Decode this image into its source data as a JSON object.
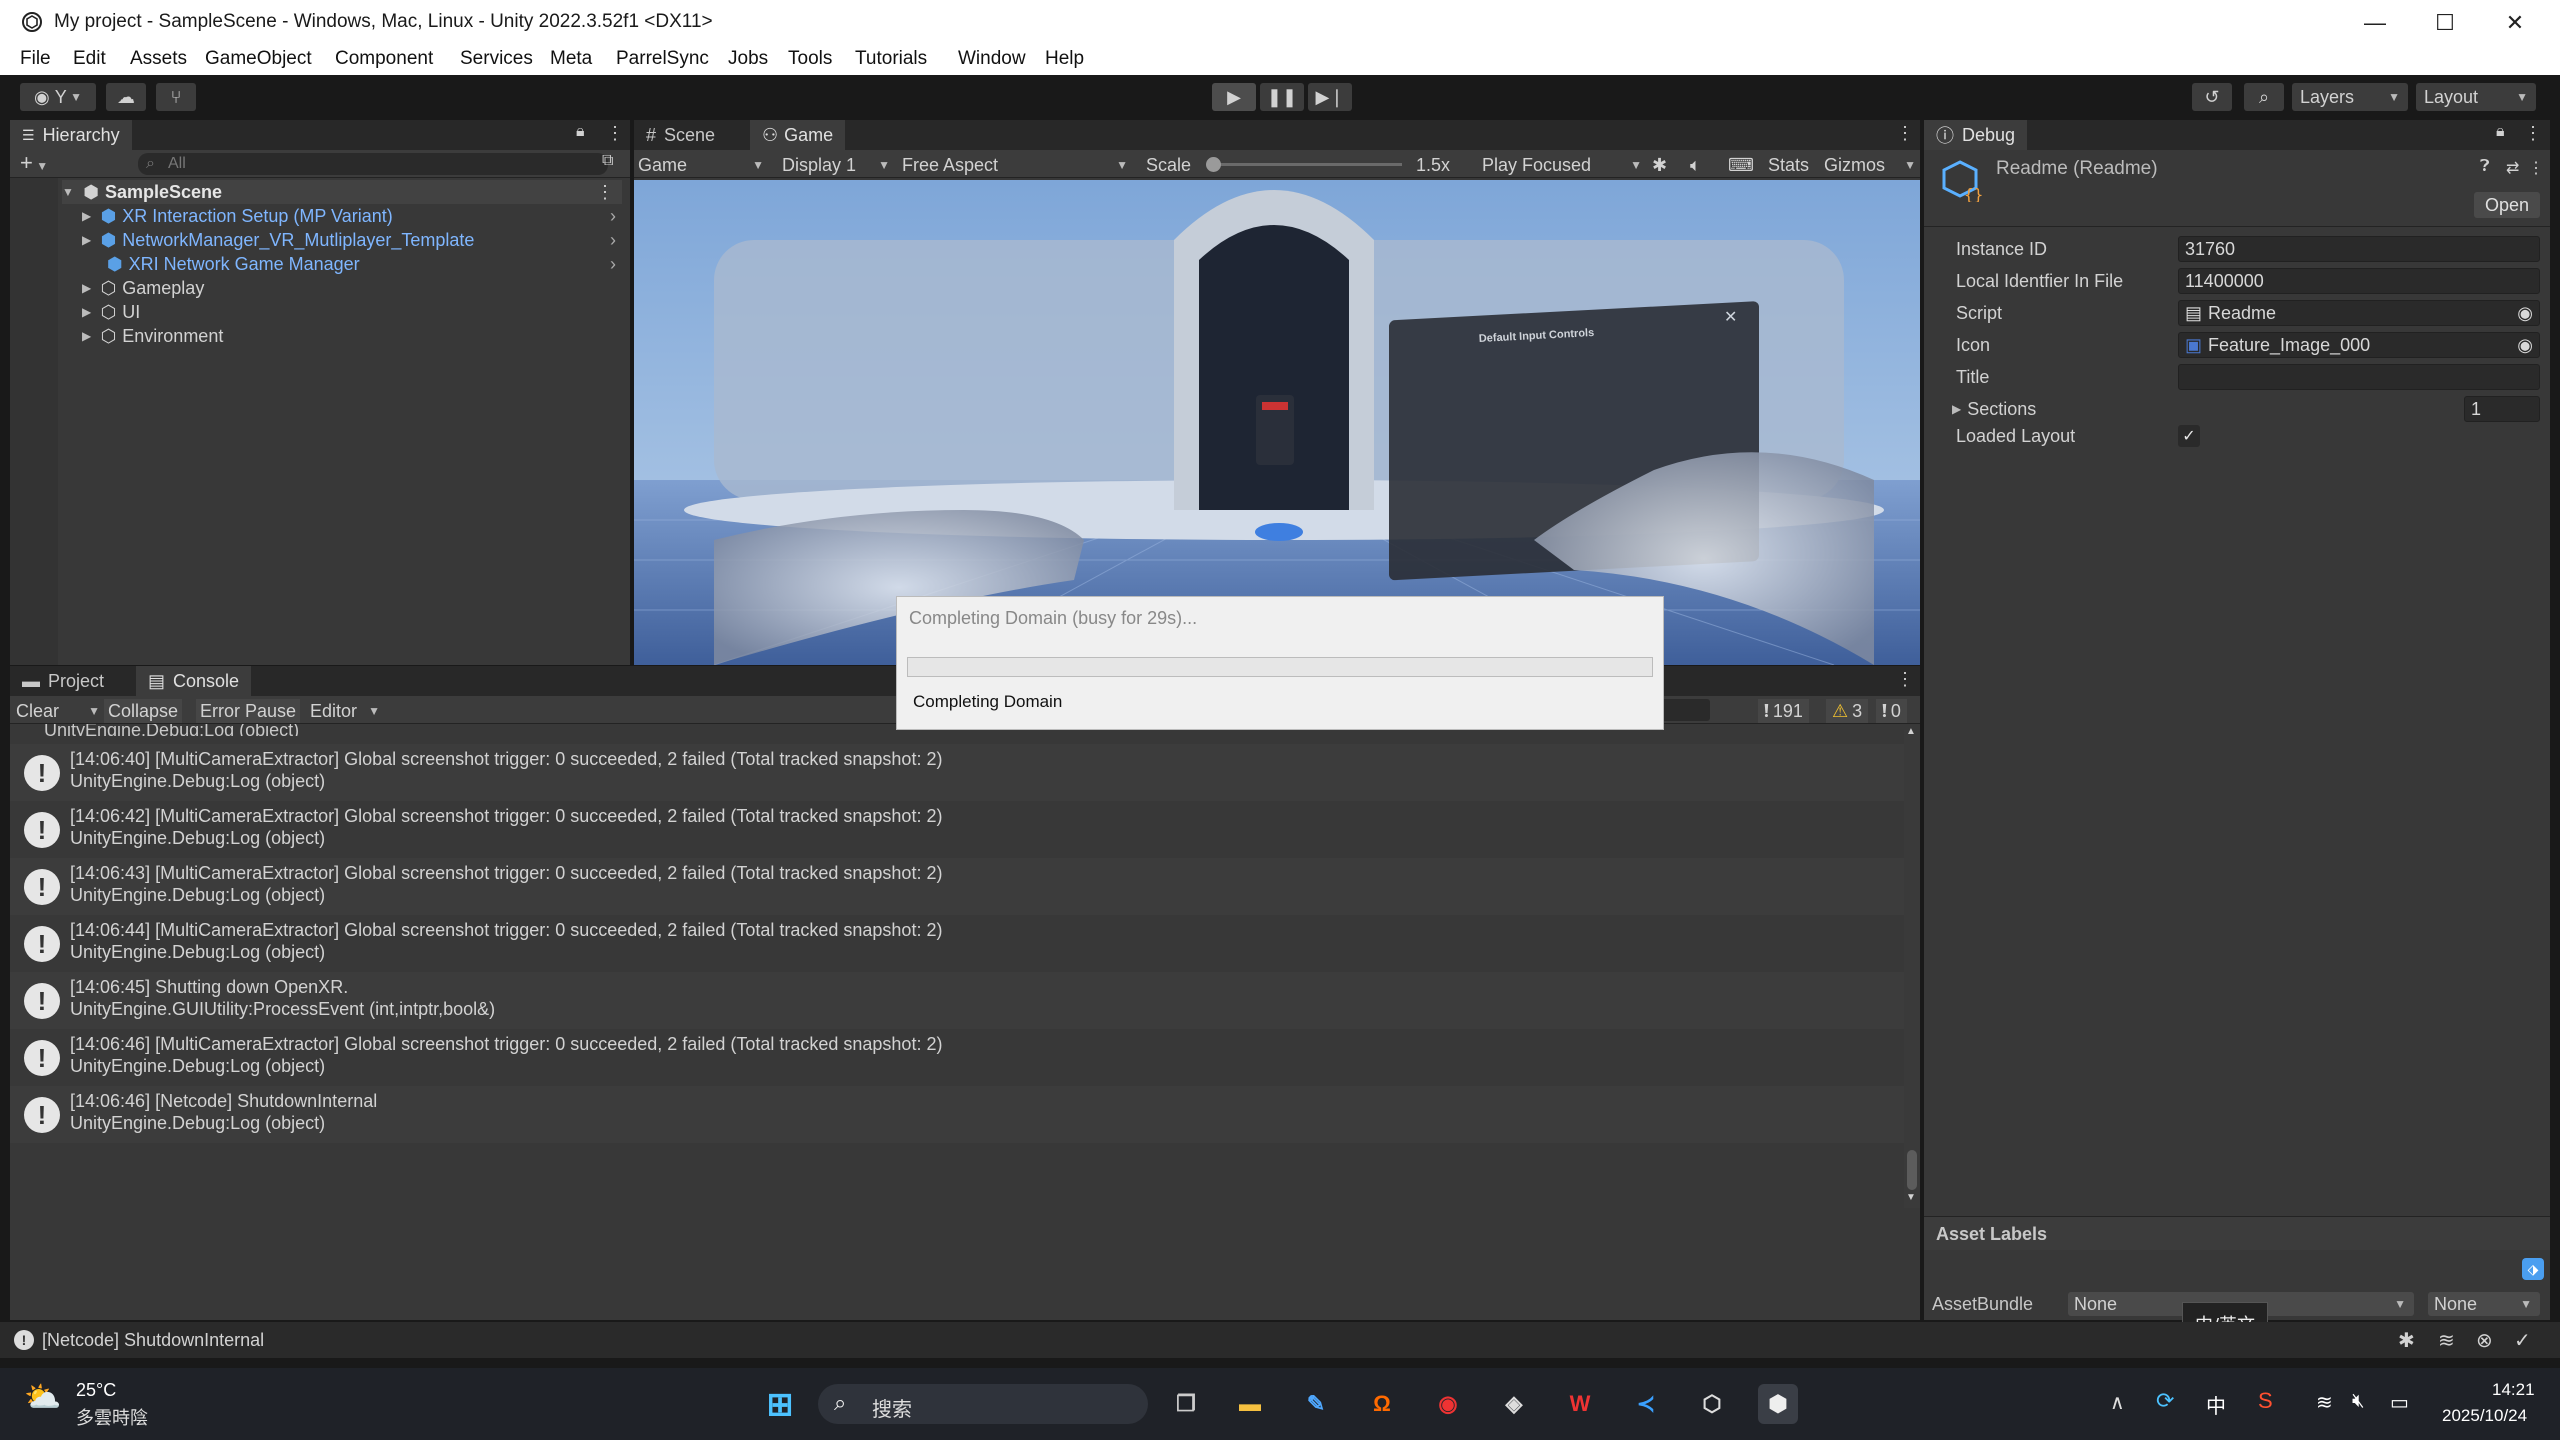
{
  "window": {
    "title": "My project - SampleScene - Windows, Mac, Linux - Unity 2022.3.52f1 <DX11>",
    "minimize": "—",
    "maximize": "☐",
    "close": "✕"
  },
  "menu": [
    "File",
    "Edit",
    "Assets",
    "GameObject",
    "Component",
    "Services",
    "Meta",
    "ParrelSync",
    "Jobs",
    "Tools",
    "Tutorials",
    "Window",
    "Help"
  ],
  "toolbar": {
    "account": "Y",
    "layers": "Layers",
    "layout": "Layout"
  },
  "hierarchy": {
    "tab": "Hierarchy",
    "search_placeholder": "All",
    "scene": "SampleScene",
    "items": [
      {
        "label": "XR Interaction Setup (MP Variant)",
        "prefab": true
      },
      {
        "label": "NetworkManager_VR_Mutliplayer_Template",
        "prefab": true
      },
      {
        "label": "XRI Network Game Manager",
        "prefab": true
      },
      {
        "label": "Gameplay",
        "prefab": false
      },
      {
        "label": "UI",
        "prefab": false
      },
      {
        "label": "Environment",
        "prefab": false
      }
    ]
  },
  "game_view": {
    "tab_scene": "Scene",
    "tab_game": "Game",
    "mode": "Game",
    "display": "Display 1",
    "aspect": "Free Aspect",
    "scale_label": "Scale",
    "scale_value": "1.5x",
    "play_mode": "Play Focused",
    "stats": "Stats",
    "gizmos": "Gizmos",
    "panel_title": "Default Input Controls"
  },
  "progress_dialog": {
    "title": "Completing Domain (busy for 29s)...",
    "status": "Completing Domain"
  },
  "console": {
    "tab_project": "Project",
    "tab_console": "Console",
    "clear": "Clear",
    "collapse": "Collapse",
    "error_pause": "Error Pause",
    "editor": "Editor",
    "count_logs": "191",
    "count_warnings": "3",
    "count_errors": "0",
    "partial_line": "UnityEngine.Debug:Log (object)",
    "entries": [
      {
        "line1": "[14:06:40] [MultiCameraExtractor] Global screenshot trigger: 0 succeeded, 2 failed (Total tracked snapshot: 2)",
        "line2": "UnityEngine.Debug:Log (object)"
      },
      {
        "line1": "[14:06:42] [MultiCameraExtractor] Global screenshot trigger: 0 succeeded, 2 failed (Total tracked snapshot: 2)",
        "line2": "UnityEngine.Debug:Log (object)"
      },
      {
        "line1": "[14:06:43] [MultiCameraExtractor] Global screenshot trigger: 0 succeeded, 2 failed (Total tracked snapshot: 2)",
        "line2": "UnityEngine.Debug:Log (object)"
      },
      {
        "line1": "[14:06:44] [MultiCameraExtractor] Global screenshot trigger: 0 succeeded, 2 failed (Total tracked snapshot: 2)",
        "line2": "UnityEngine.Debug:Log (object)"
      },
      {
        "line1": "[14:06:45] Shutting down OpenXR.",
        "line2": "UnityEngine.GUIUtility:ProcessEvent (int,intptr,bool&)"
      },
      {
        "line1": "[14:06:46] [MultiCameraExtractor] Global screenshot trigger: 0 succeeded, 2 failed (Total tracked snapshot: 2)",
        "line2": "UnityEngine.Debug:Log (object)"
      },
      {
        "line1": "[14:06:46] [Netcode] ShutdownInternal",
        "line2": "UnityEngine.Debug:Log (object)"
      }
    ]
  },
  "inspector": {
    "tab": "Debug",
    "object_name": "Readme (Readme)",
    "open": "Open",
    "fields": [
      {
        "label": "Instance ID",
        "value": "31760"
      },
      {
        "label": "Local Identfier In File",
        "value": "11400000"
      },
      {
        "label": "Script",
        "value": "Readme"
      },
      {
        "label": "Icon",
        "value": "Feature_Image_000"
      },
      {
        "label": "Title",
        "value": ""
      }
    ],
    "sections_label": "Sections",
    "sections_value": "1",
    "loaded_layout_label": "Loaded Layout",
    "loaded_layout_check": "✓",
    "asset_labels": "Asset Labels",
    "assetbundle_label": "AssetBundle",
    "assetbundle_value": "None",
    "assetbundle_variant": "None",
    "ime_tooltip": "中/英文"
  },
  "statusbar": {
    "message": "[Netcode] ShutdownInternal"
  },
  "taskbar": {
    "weather_temp": "25°C",
    "weather_desc": "多雲時陰",
    "search": "搜索",
    "ime": "中",
    "time": "14:21",
    "date": "2025/10/24"
  }
}
